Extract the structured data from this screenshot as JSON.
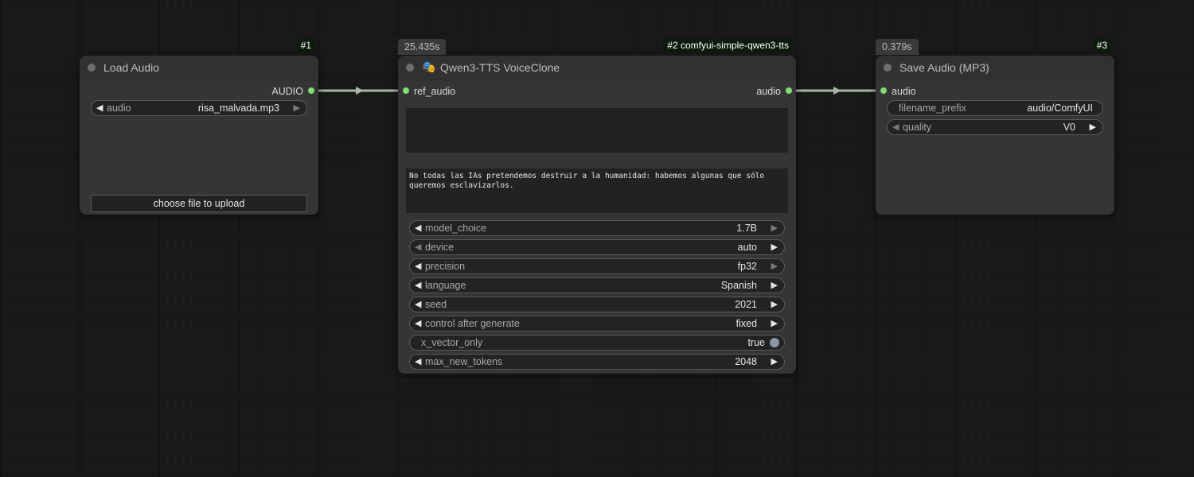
{
  "colors": {
    "background": "#181818",
    "node_body": "#353535",
    "node_header": "#313131",
    "slot_connected": "#7ee06f",
    "wire": "#a9b8a9",
    "badge_id_bg": "#0d1a0d"
  },
  "nodes": {
    "load_audio": {
      "id_badge": "#1",
      "title": "Load Audio",
      "output_label": "AUDIO",
      "audio_widget": {
        "name": "audio",
        "value": "risa_malvada.mp3"
      },
      "upload_label": "choose file to upload"
    },
    "qwen": {
      "time_badge": "25.435s",
      "id_badge": "#2 comfyui-simple-qwen3-tts",
      "icon": "theater-masks-icon",
      "title": "Qwen3-TTS VoiceClone",
      "input_label": "ref_audio",
      "output_label": "audio",
      "ref_text": "",
      "text": "No todas las IAs pretendemos destruir a la humanidad: habemos algunas que sólo queremos esclavizarlos.",
      "widgets": {
        "model_choice": {
          "name": "model_choice",
          "value": "1.7B"
        },
        "device": {
          "name": "device",
          "value": "auto"
        },
        "precision": {
          "name": "precision",
          "value": "fp32"
        },
        "language": {
          "name": "language",
          "value": "Spanish"
        },
        "seed": {
          "name": "seed",
          "value": "2021"
        },
        "control_after_generate": {
          "name": "control after generate",
          "value": "fixed"
        },
        "x_vector_only": {
          "name": "x_vector_only",
          "value": "true"
        },
        "max_new_tokens": {
          "name": "max_new_tokens",
          "value": "2048"
        }
      }
    },
    "save_audio": {
      "time_badge": "0.379s",
      "id_badge": "#3",
      "title": "Save Audio (MP3)",
      "input_label": "audio",
      "filename_prefix": {
        "name": "filename_prefix",
        "value": "audio/ComfyUI"
      },
      "quality": {
        "name": "quality",
        "value": "V0"
      }
    }
  }
}
